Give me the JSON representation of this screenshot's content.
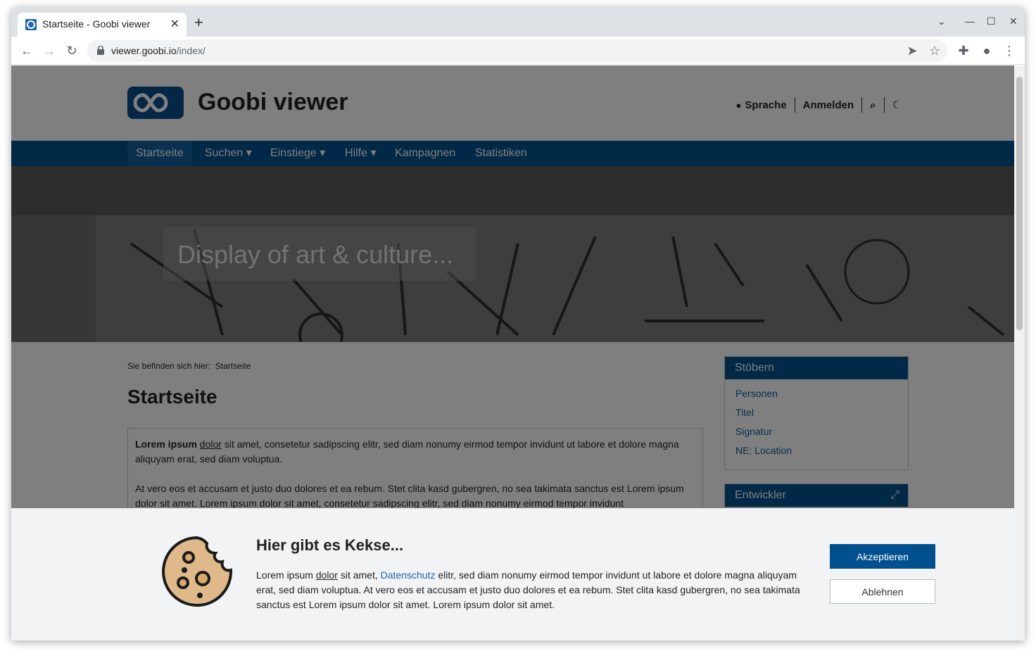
{
  "browser": {
    "tab_title": "Startseite - Goobi viewer",
    "url_host": "viewer.goobi.io",
    "url_path": "/index/"
  },
  "site": {
    "name": "Goobi viewer",
    "header_links": [
      "Sprache",
      "Anmelden"
    ]
  },
  "nav": [
    {
      "label": "Startseite",
      "active": true
    },
    {
      "label": "Suchen",
      "dropdown": true
    },
    {
      "label": "Einstiege",
      "dropdown": true
    },
    {
      "label": "Hilfe",
      "dropdown": true
    },
    {
      "label": "Kampagnen"
    },
    {
      "label": "Statistiken"
    }
  ],
  "hero": {
    "caption": "Display of art & culture..."
  },
  "breadcrumb": {
    "prefix": "Sie befinden sich hier:",
    "current": "Startseite"
  },
  "page": {
    "title": "Startseite",
    "p1_bold": "Lorem ipsum",
    "p1_link": "dolor",
    "p1_rest": " sit amet, consetetur sadipscing elitr, sed diam nonumy eirmod tempor invidunt ut labore et dolore magna aliquyam erat, sed diam voluptua.",
    "p2": "At vero eos et accusam et justo duo dolores et ea rebum. Stet clita kasd gubergren, no sea takimata sanctus est Lorem ipsum dolor sit amet. Lorem ipsum dolor sit amet, consetetur sadipscing elitr, sed diam nonumy eirmod tempor invidunt"
  },
  "widgets": {
    "browse": {
      "title": "Stöbern",
      "items": [
        "Personen",
        "Titel",
        "Signatur",
        "NE: Location"
      ]
    },
    "developer": {
      "title": "Entwickler"
    }
  },
  "cookie": {
    "title": "Hier gibt es Kekse...",
    "text_a": "Lorem ipsum ",
    "text_u": "dolor",
    "text_b": " sit amet, ",
    "text_link": "Datenschutz",
    "text_c": " elitr, sed diam nonumy eirmod tempor invidunt ut labore et dolore magna aliquyam erat, sed diam voluptua. At vero eos et accusam et justo duo dolores et ea rebum. Stet clita kasd gubergren, no sea takimata sanctus est Lorem ipsum dolor sit amet. Lorem ipsum dolor sit amet.",
    "accept": "Akzeptieren",
    "decline": "Ablehnen"
  },
  "colors": {
    "brand": "#00508f",
    "link": "#1e66b4"
  }
}
